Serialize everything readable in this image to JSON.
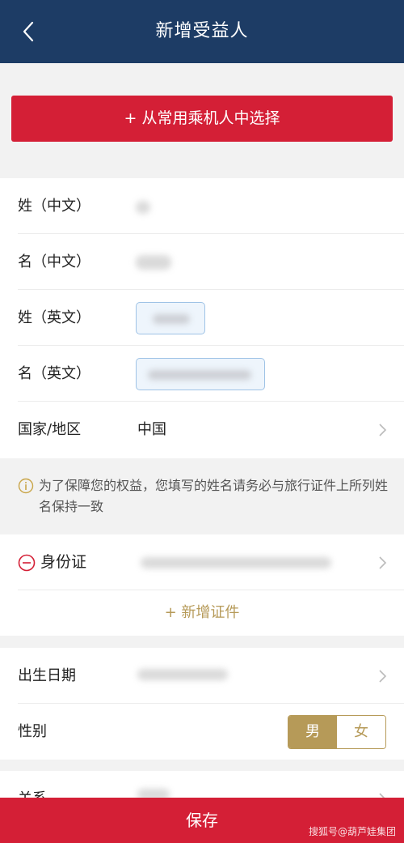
{
  "header": {
    "title": "新增受益人"
  },
  "pick_button": {
    "label": "+ 从常用乘机人中选择"
  },
  "form": {
    "surname_cn_label": "姓（中文）",
    "given_cn_label": "名（中文）",
    "surname_en_label": "姓（英文）",
    "given_en_label": "名（英文）",
    "country_label": "国家/地区",
    "country_value": "中国"
  },
  "notice": {
    "text": "为了保障您的权益，您填写的姓名请务必与旅行证件上所列姓名保持一致"
  },
  "id_section": {
    "id_type_label": "身份证",
    "add_cert_label": "+ 新增证件"
  },
  "personal": {
    "birth_label": "出生日期",
    "gender_label": "性别",
    "gender_options": [
      "男",
      "女"
    ],
    "gender_selected": "男",
    "relation_label": "关系"
  },
  "footer": {
    "save_label": "保存",
    "watermark": "搜狐号@葫芦娃集团"
  },
  "colors": {
    "header_bg": "#1d3c65",
    "primary_red": "#d41f36",
    "gold": "#b69a58"
  },
  "icons": {
    "back": "chevron-left-icon",
    "chevron": "chevron-right-icon",
    "info": "info-circle-icon",
    "remove": "minus-circle-icon"
  }
}
